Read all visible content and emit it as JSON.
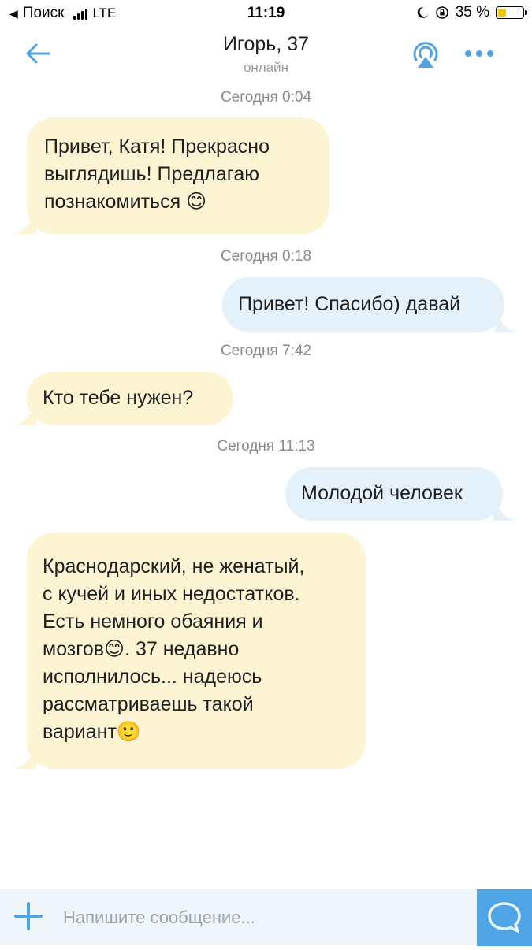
{
  "status_bar": {
    "back_label": "Поиск",
    "network": "LTE",
    "time": "11:19",
    "battery": "35 %",
    "battery_level": 0.35
  },
  "header": {
    "title": "Игорь, 37",
    "subtitle": "онлайн"
  },
  "messages": [
    {
      "time": "Сегодня 0:04",
      "direction": "incoming",
      "lines": [
        "Привет, Катя! Прекрасно",
        "выглядишь! Предлагаю",
        "познакомиться 😊"
      ]
    },
    {
      "time": "Сегодня 0:18",
      "direction": "outgoing",
      "lines": [
        "Привет! Спасибо) давай"
      ]
    },
    {
      "time": "Сегодня 7:42",
      "direction": "incoming",
      "lines": [
        "Кто тебе нужен?"
      ]
    },
    {
      "time": "Сегодня 11:13",
      "direction": "outgoing",
      "lines": [
        "Молодой человек"
      ]
    },
    {
      "time": "",
      "direction": "incoming",
      "lines": [
        "Краснодарский, не женатый,",
        "с кучей и иных недостатков.",
        "Есть немного обаяния и",
        "мозгов😊. 37 недавно",
        "исполнилось... надеюсь",
        "рассматриваешь такой",
        "вариант🙂"
      ]
    }
  ],
  "input": {
    "placeholder": "Напишите сообщение..."
  },
  "colors": {
    "accent": "#4fa4e5",
    "incoming_bubble": "#fcf4d3",
    "outgoing_bubble": "#e4f1fb"
  }
}
